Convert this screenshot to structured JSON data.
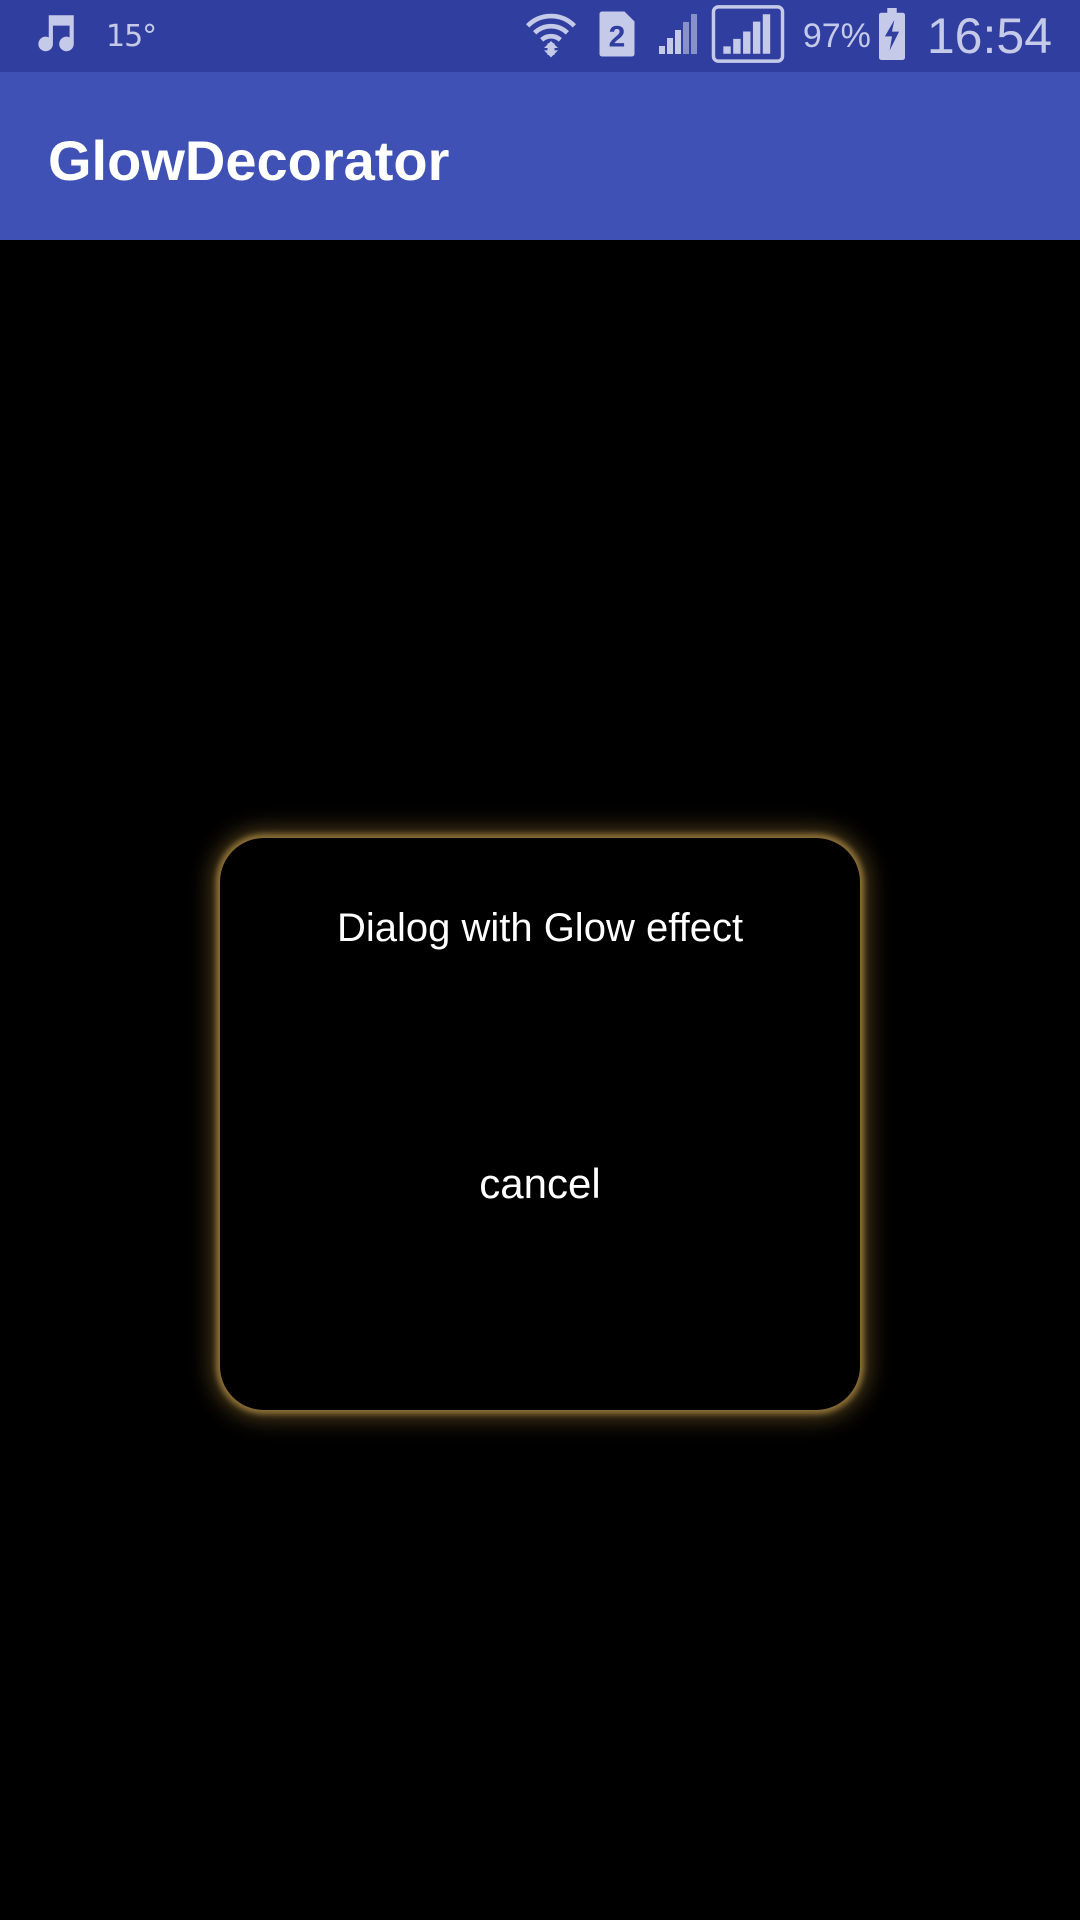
{
  "status_bar": {
    "left_icons": [
      "music-note-icon"
    ],
    "temperature": "15°",
    "right_icons": [
      "wifi-icon",
      "sim-2-icon",
      "signal-icon",
      "signal-icon-boxed",
      "battery-charging-icon"
    ],
    "battery_percent": "97%",
    "time": "16:54"
  },
  "app_bar": {
    "title": "GlowDecorator"
  },
  "dialog": {
    "message": "Dialog with Glow effect",
    "cancel_label": "cancel",
    "glow_color": "#9c7e45"
  },
  "colors": {
    "status_bar": "#303f9f",
    "app_bar": "#3f51b5",
    "background": "#000000"
  }
}
